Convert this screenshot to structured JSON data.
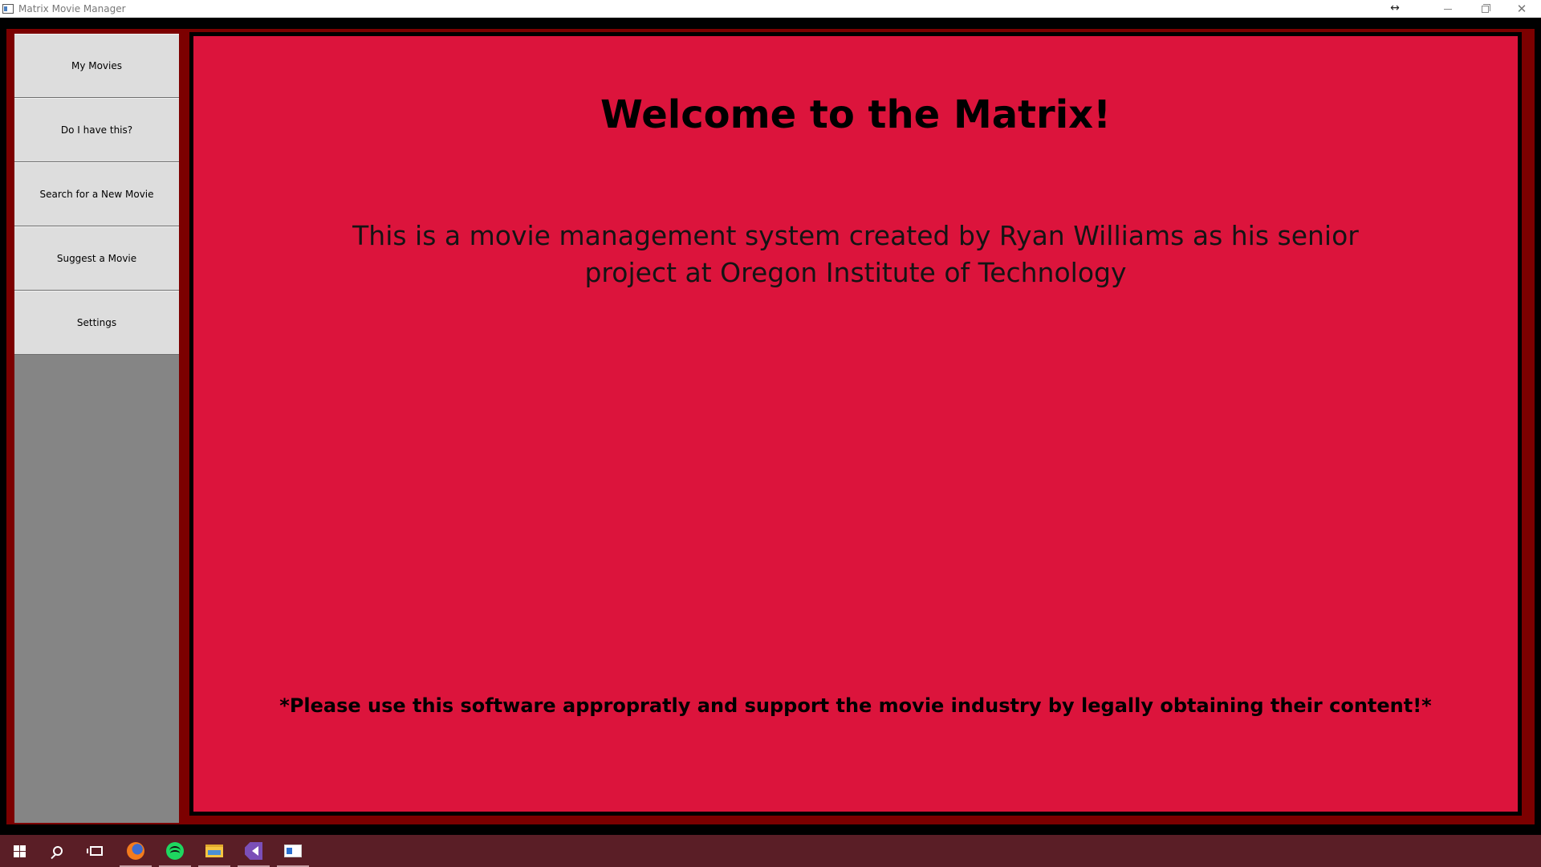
{
  "window": {
    "title": "Matrix Movie Manager"
  },
  "title_bar_icons": [
    "app-icon",
    "resize-arrows-icon",
    "minimize-icon",
    "restore-icon",
    "close-icon"
  ],
  "sidebar": {
    "items": [
      {
        "label": "My Movies"
      },
      {
        "label": "Do I have this?"
      },
      {
        "label": "Search for a New Movie"
      },
      {
        "label": "Suggest a Movie"
      },
      {
        "label": "Settings"
      }
    ]
  },
  "main": {
    "welcome": "Welcome to the Matrix!",
    "description": "This is a movie management system created by Ryan Williams as his senior project at Oregon Institute of Technology",
    "disclaimer": "*Please use this software appropratly and support the movie industry by legally obtaining their content!*"
  },
  "taskbar": {
    "items": [
      "start-icon",
      "search-icon",
      "task-view-icon",
      "firefox-icon",
      "spotify-icon",
      "file-explorer-icon",
      "visual-studio-icon",
      "matrix-app-icon"
    ]
  },
  "colors": {
    "content_background": "#dc143c",
    "frame": "#7c0000",
    "sidebar_background": "#858585",
    "nav_button": "#dddddd",
    "taskbar": "#5a1e26"
  }
}
